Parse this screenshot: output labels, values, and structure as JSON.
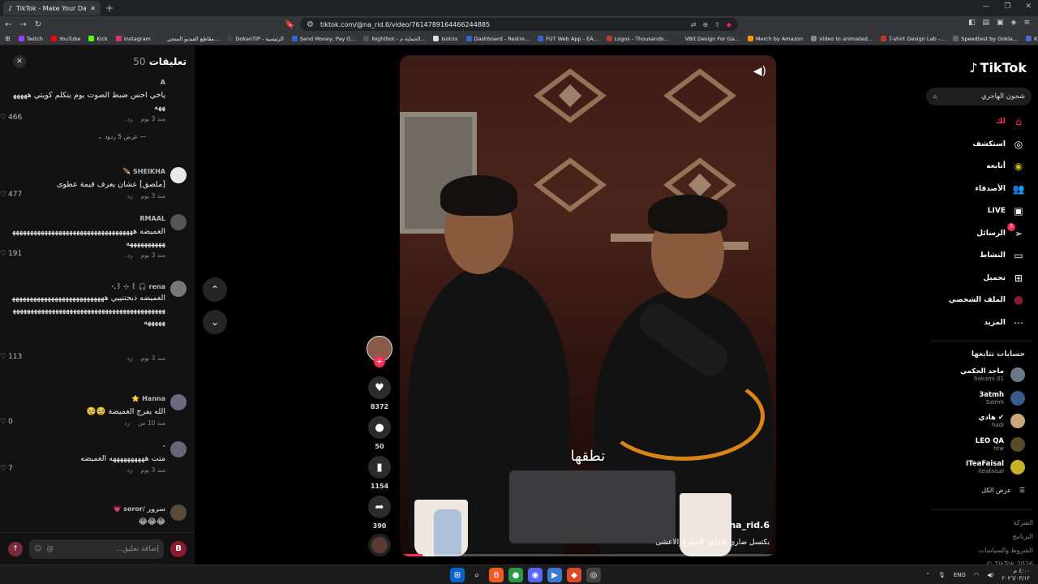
{
  "browser": {
    "tab_title": "TikTok - Make Your Day",
    "url": "tiktok.com/@na_rid.6/video/7614789164466244885",
    "bookmarks": [
      "Twitch",
      "YouTube",
      "Kick",
      "Instagram",
      "مقاطع الفيديو المتجي...",
      "DokanTIP - الرئيسية",
      "Send Money, Pay O...",
      "Nightbot - الحماية م...",
      "Isotrix",
      "Dashboard - Restre...",
      "FUT Web App - EA...",
      "Logos - Thousands...",
      "VBit Design For Ga...",
      "Merch by Amazon",
      "Video to animated...",
      "T-shirt Design Lab -...",
      "Speedtest by Ookla...",
      "Kimetsu no Yai... انمي"
    ]
  },
  "comments": {
    "title": "تعليقات",
    "count": "50",
    "items": [
      {
        "user": "A",
        "text": "ياخي احس ضبط الصوت يوم يتكلم كويتي هههههههه",
        "time": "منذ 3 يوم",
        "reply": "رد",
        "likes": "466",
        "avatar_color": "#121212"
      },
      {
        "user": "SHEIKHA 🪶",
        "text": "[ملصق] عشان يعرف قيمة عطوى",
        "time": "منذ 3 يوم",
        "reply": "رد",
        "likes": "477",
        "avatar_color": "#e8e8e8"
      },
      {
        "user": "RMAAL",
        "text": "الغميضه هههههههههههههههههههههههههههههههههههههههههههههه",
        "time": "منذ 3 يوم",
        "reply": "رد",
        "likes": "191",
        "avatar_color": "#555"
      },
      {
        "user": "rena 🎧 ꒰ ⊹ ꒱.·",
        "text": "الغميضه ذبحتنييي هههههههههههههههههههههههههههههههههههههههههههههههههههههههههههههههههههههههههههه",
        "time": "منذ 3 يوم",
        "reply": "رد",
        "likes": "113",
        "avatar_color": "#777"
      },
      {
        "user": "Hanna ⭐",
        "text": "الله يفرج الغميضة 🥹🥹",
        "time": "منذ 10 س",
        "reply": "رد",
        "likes": "0",
        "avatar_color": "#6a6a80"
      },
      {
        "user": "-",
        "text": "متت ههههههههههه الغميضه",
        "time": "منذ 3 يوم",
        "reply": "رد",
        "likes": "7",
        "avatar_color": "#667"
      },
      {
        "user": "سرور /soror 💗",
        "text": "😂😂😂",
        "time": "",
        "reply": "",
        "likes": "",
        "avatar_color": "#5a4a3a"
      }
    ],
    "show_replies": "عرض 5 ردود",
    "input_placeholder": "إضافة تعليق..."
  },
  "video": {
    "subtitle": "تطقها",
    "author": "na_rid.6",
    "caption": "بكتسل ضاري #دايلز #شارع_الاعشى",
    "progress": 0.06,
    "actions": {
      "likes": "8372",
      "comments": "50",
      "saves": "1154",
      "shares": "390"
    }
  },
  "sidebar": {
    "logo": "TikTok",
    "search_value": "شجون الهاجري",
    "nav": [
      {
        "label": "لك",
        "icon": "⌂",
        "name": "home-icon",
        "active": true
      },
      {
        "label": "استكشف",
        "icon": "◎",
        "name": "compass-icon",
        "active": false
      },
      {
        "label": "أتابعه",
        "icon": "◉",
        "name": "following-icon",
        "active": false
      },
      {
        "label": "الأصدقاء",
        "icon": "👥",
        "name": "friends-icon",
        "active": false
      },
      {
        "label": "LIVE",
        "icon": "▣",
        "name": "live-icon",
        "active": false
      },
      {
        "label": "الرسائل",
        "icon": "➢",
        "name": "messages-icon",
        "active": false
      },
      {
        "label": "النشاط",
        "icon": "▭",
        "name": "activity-icon",
        "active": false
      },
      {
        "label": "تحميل",
        "icon": "⊞",
        "name": "upload-icon",
        "active": false
      },
      {
        "label": "الملف الشخصي",
        "icon": "●",
        "name": "profile-icon",
        "active": false
      },
      {
        "label": "المزيد",
        "icon": "⋯",
        "name": "more-icon",
        "active": false
      }
    ],
    "messages_badge": "3",
    "following_title": "حسابات تتابعها",
    "following": [
      {
        "name": "ماجد الحكمي",
        "handle": "hakami.01",
        "color": "#6a7a8a"
      },
      {
        "name": "3atmh",
        "handle": "3atmh",
        "color": "#3a5a8a"
      },
      {
        "name": "هادي ✔",
        "handle": "hadi",
        "color": "#c8a878"
      },
      {
        "name": "LEO QA",
        "handle": "htw",
        "color": "#5a4a2a"
      },
      {
        "name": "ITeaFaisal",
        "handle": "iteafaisal",
        "color": "#c8b028"
      }
    ],
    "see_all": "عرض الكل",
    "footer": [
      "الشركة",
      "البرنامج",
      "الشروط والسياسات",
      "TikTok 2026 ©"
    ]
  },
  "taskbar": {
    "lang": "ENG",
    "time": "٤:٠٠ م",
    "date": "٢٠٢٦/٠٣/١٢"
  }
}
